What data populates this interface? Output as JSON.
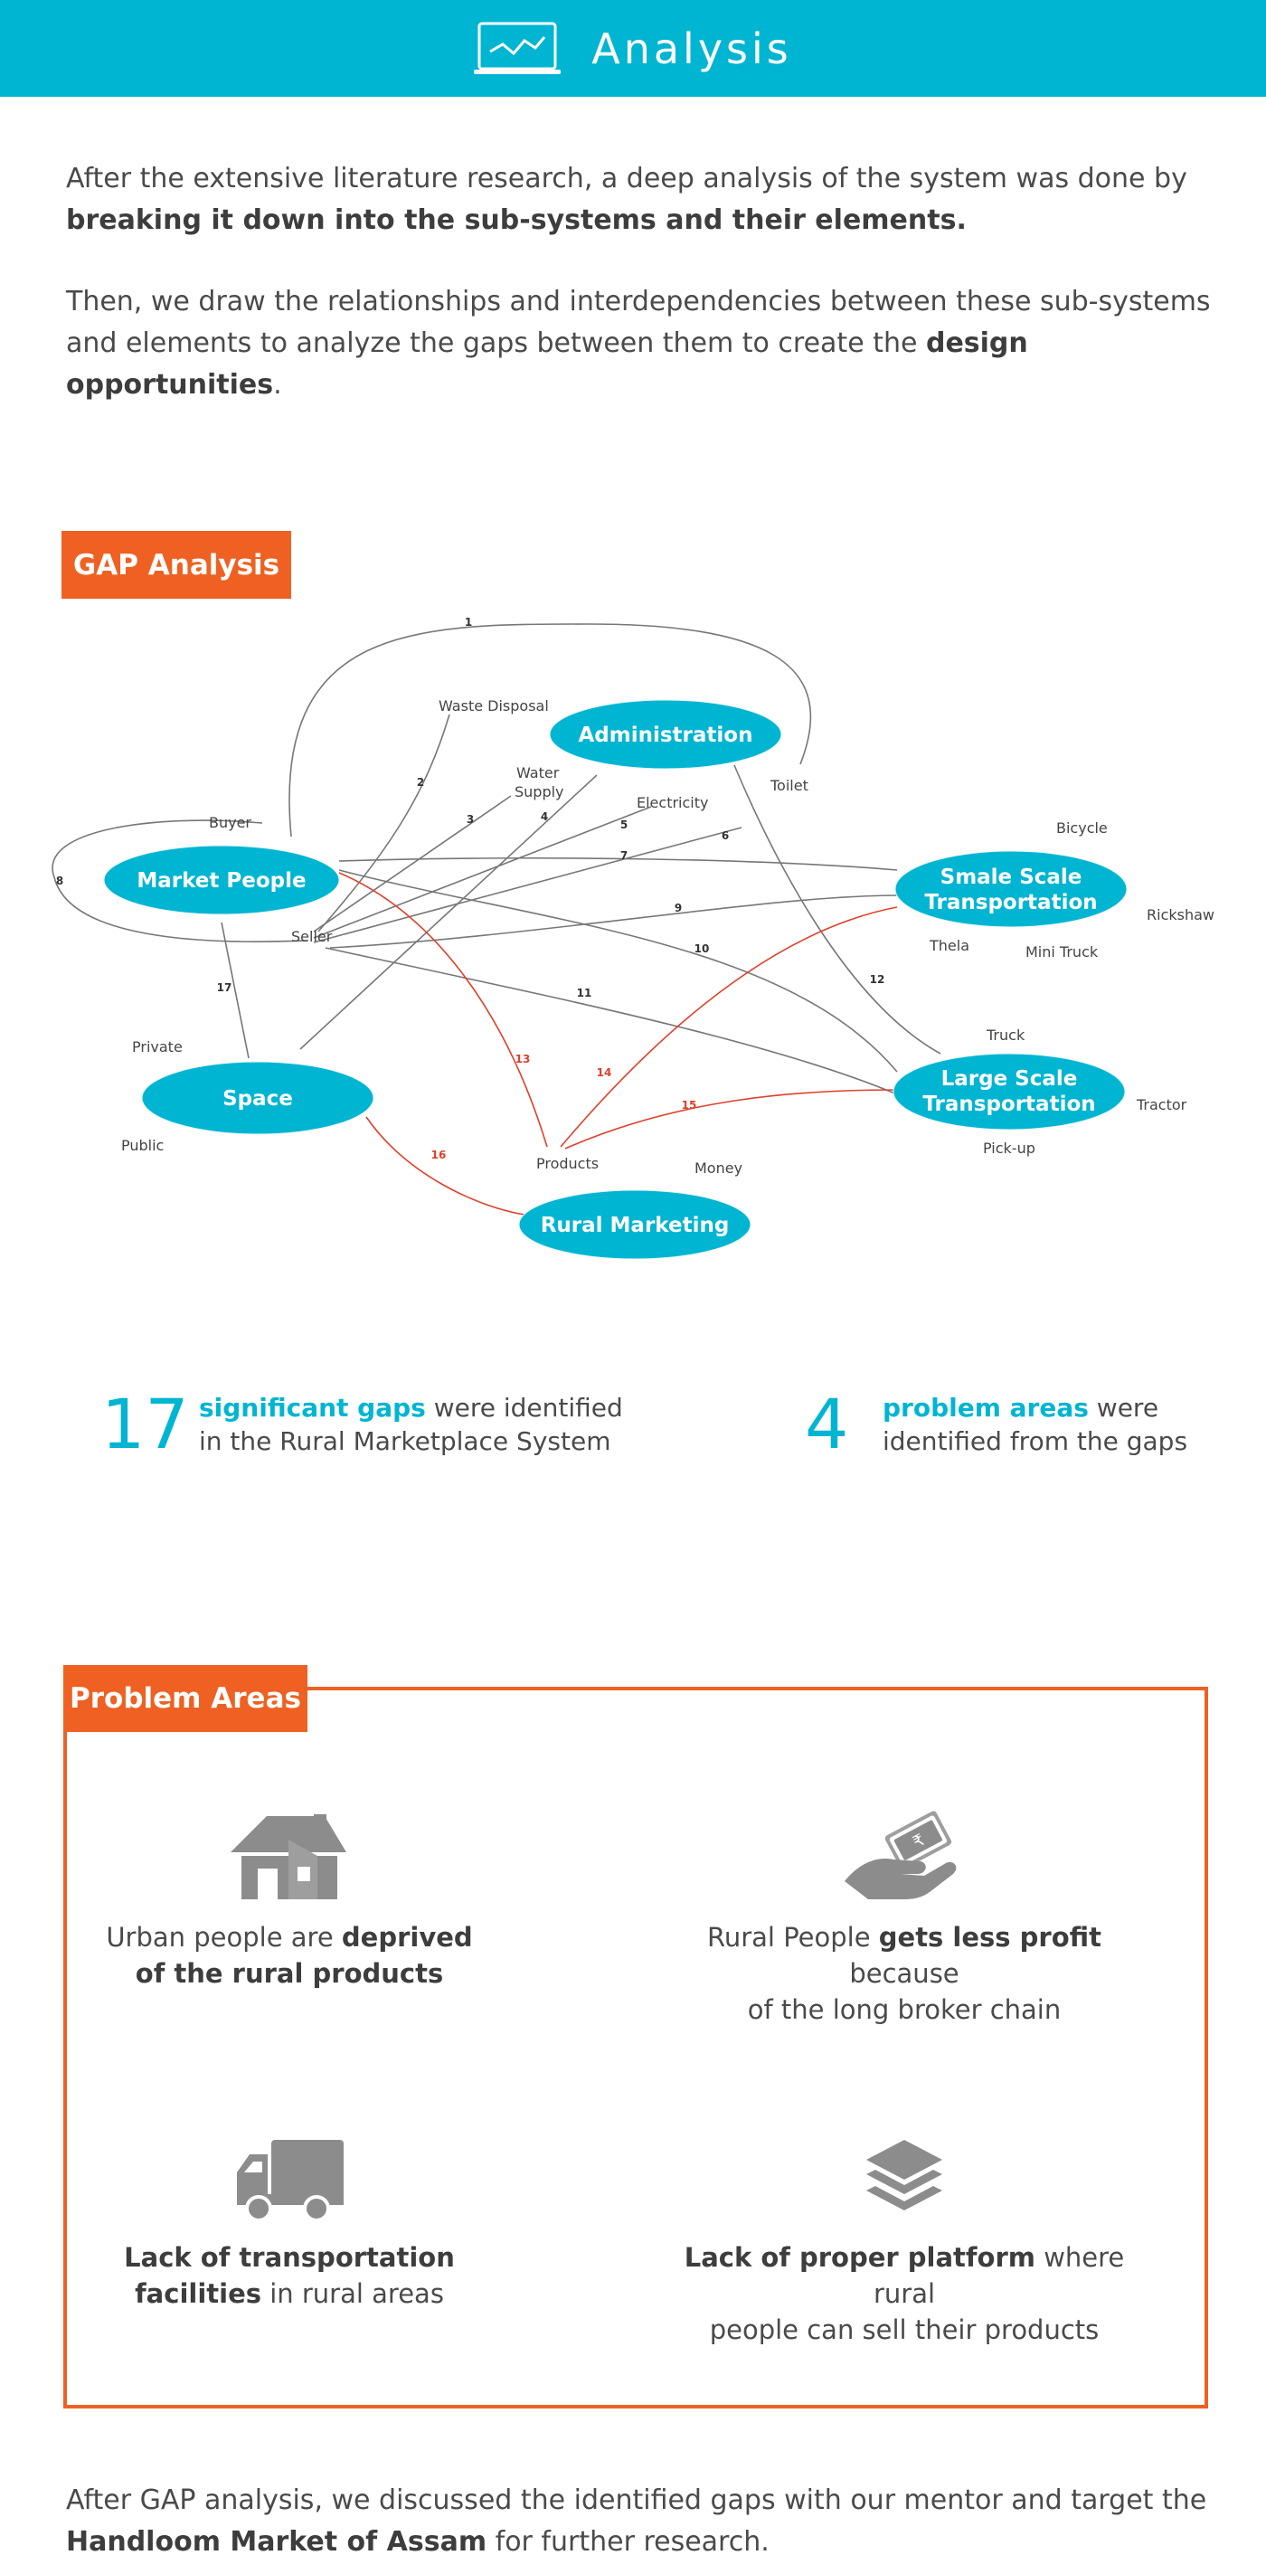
{
  "header": {
    "title": "Analysis",
    "icon": "monitor-chart-icon"
  },
  "intro": {
    "p1_text": "After the extensive literature research, a deep analysis of the system was done by ",
    "p1_bold": "breaking it down into the sub-systems and their elements.",
    "p2_text": "Then, we draw the relationships and interdependencies between these sub-systems and elements to analyze the gaps between them to create the ",
    "p2_bold": "design opportunities",
    "p2_end": "."
  },
  "gap_analysis": {
    "label": "GAP Analysis",
    "nodes": {
      "administration": "Administration",
      "market_people": "Market People",
      "small_transport_1": "Smale Scale",
      "small_transport_2": "Transportation",
      "large_transport_1": "Large Scale",
      "large_transport_2": "Transportation",
      "space": "Space",
      "rural_marketing": "Rural Marketing"
    },
    "elements": {
      "waste_disposal": "Waste Disposal",
      "water_supply_1": "Water",
      "water_supply_2": "Supply",
      "electricity": "Electricity",
      "toilet": "Toilet",
      "buyer": "Buyer",
      "seller": "Seller",
      "bicycle": "Bicycle",
      "rickshaw": "Rickshaw",
      "thela": "Thela",
      "mini_truck": "Mini Truck",
      "truck": "Truck",
      "tractor": "Tractor",
      "pickup": "Pick-up",
      "private": "Private",
      "public": "Public",
      "products": "Products",
      "money": "Money"
    },
    "gap_numbers": [
      "1",
      "2",
      "3",
      "4",
      "5",
      "6",
      "7",
      "8",
      "9",
      "10",
      "11",
      "12",
      "13",
      "14",
      "15",
      "16",
      "17"
    ],
    "colors": {
      "node_fill": "#00b5d1",
      "gap_line": "#777777",
      "highlight_line": "#e0402a"
    }
  },
  "stats": [
    {
      "number": "17",
      "highlight": "significant gaps",
      "text1": " were identified",
      "text2": "in the Rural Marketplace System"
    },
    {
      "number": "4",
      "highlight": "problem areas",
      "text1": " were",
      "text2": "identified from the gaps"
    }
  ],
  "problem_areas": {
    "label": "Problem Areas",
    "items": [
      {
        "icon": "house-icon",
        "pre": "Urban people are ",
        "bold": "deprived",
        "line2_bold": "of the rural products",
        "post": "",
        "line2": ""
      },
      {
        "icon": "money-hand-icon",
        "pre": "Rural People ",
        "bold": "gets less profit",
        "post": " because",
        "line2": "of the long broker chain",
        "line2_bold": ""
      },
      {
        "icon": "truck-icon",
        "pre": "",
        "bold": "Lack of transportation",
        "post": "",
        "line2_bold": "facilities",
        "line2": " in rural areas"
      },
      {
        "icon": "layers-icon",
        "pre": "",
        "bold": "Lack of proper platform",
        "post": " where rural",
        "line2": "people can sell their products",
        "line2_bold": ""
      }
    ]
  },
  "outro": {
    "text": "After GAP analysis, we discussed the identified gaps with our mentor and target the ",
    "bold": "Handloom Market of Assam",
    "end": " for further research."
  },
  "colors": {
    "accent": "#00b5d1",
    "orange": "#ee6123",
    "text": "#4a4a4a",
    "icon_gray": "#8c8c8c"
  }
}
